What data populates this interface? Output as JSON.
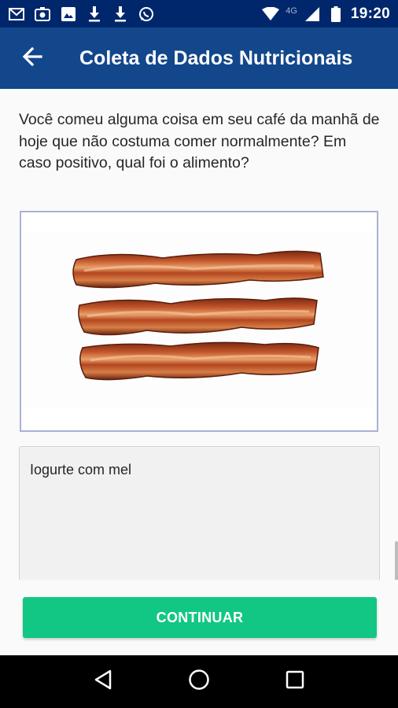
{
  "status_bar": {
    "time": "19:20",
    "network": "4G",
    "left_icons": [
      "gmail-icon",
      "photo-app-icon",
      "image-icon",
      "download-icon",
      "download-icon",
      "whatsapp-icon"
    ],
    "right_icons": [
      "wifi-icon",
      "signal-icon",
      "battery-icon"
    ]
  },
  "app_bar": {
    "title": "Coleta de Dados Nutricionais",
    "back_icon": "arrow-back-icon"
  },
  "question": {
    "text": "Você comeu alguma coisa em seu café da manhã de hoje que não costuma comer normalmente? Em caso positivo, qual foi o alimento?"
  },
  "image": {
    "subject": "bacon strips"
  },
  "answer": {
    "value": "Iogurte com mel"
  },
  "actions": {
    "continue_label": "CONTINUAR",
    "continue_color": "#12c784"
  },
  "nav_bar": {
    "icons": [
      "back-triangle-icon",
      "home-circle-icon",
      "recents-square-icon"
    ]
  },
  "colors": {
    "app_bar": "#13478b",
    "status_bar": "#00276c"
  }
}
